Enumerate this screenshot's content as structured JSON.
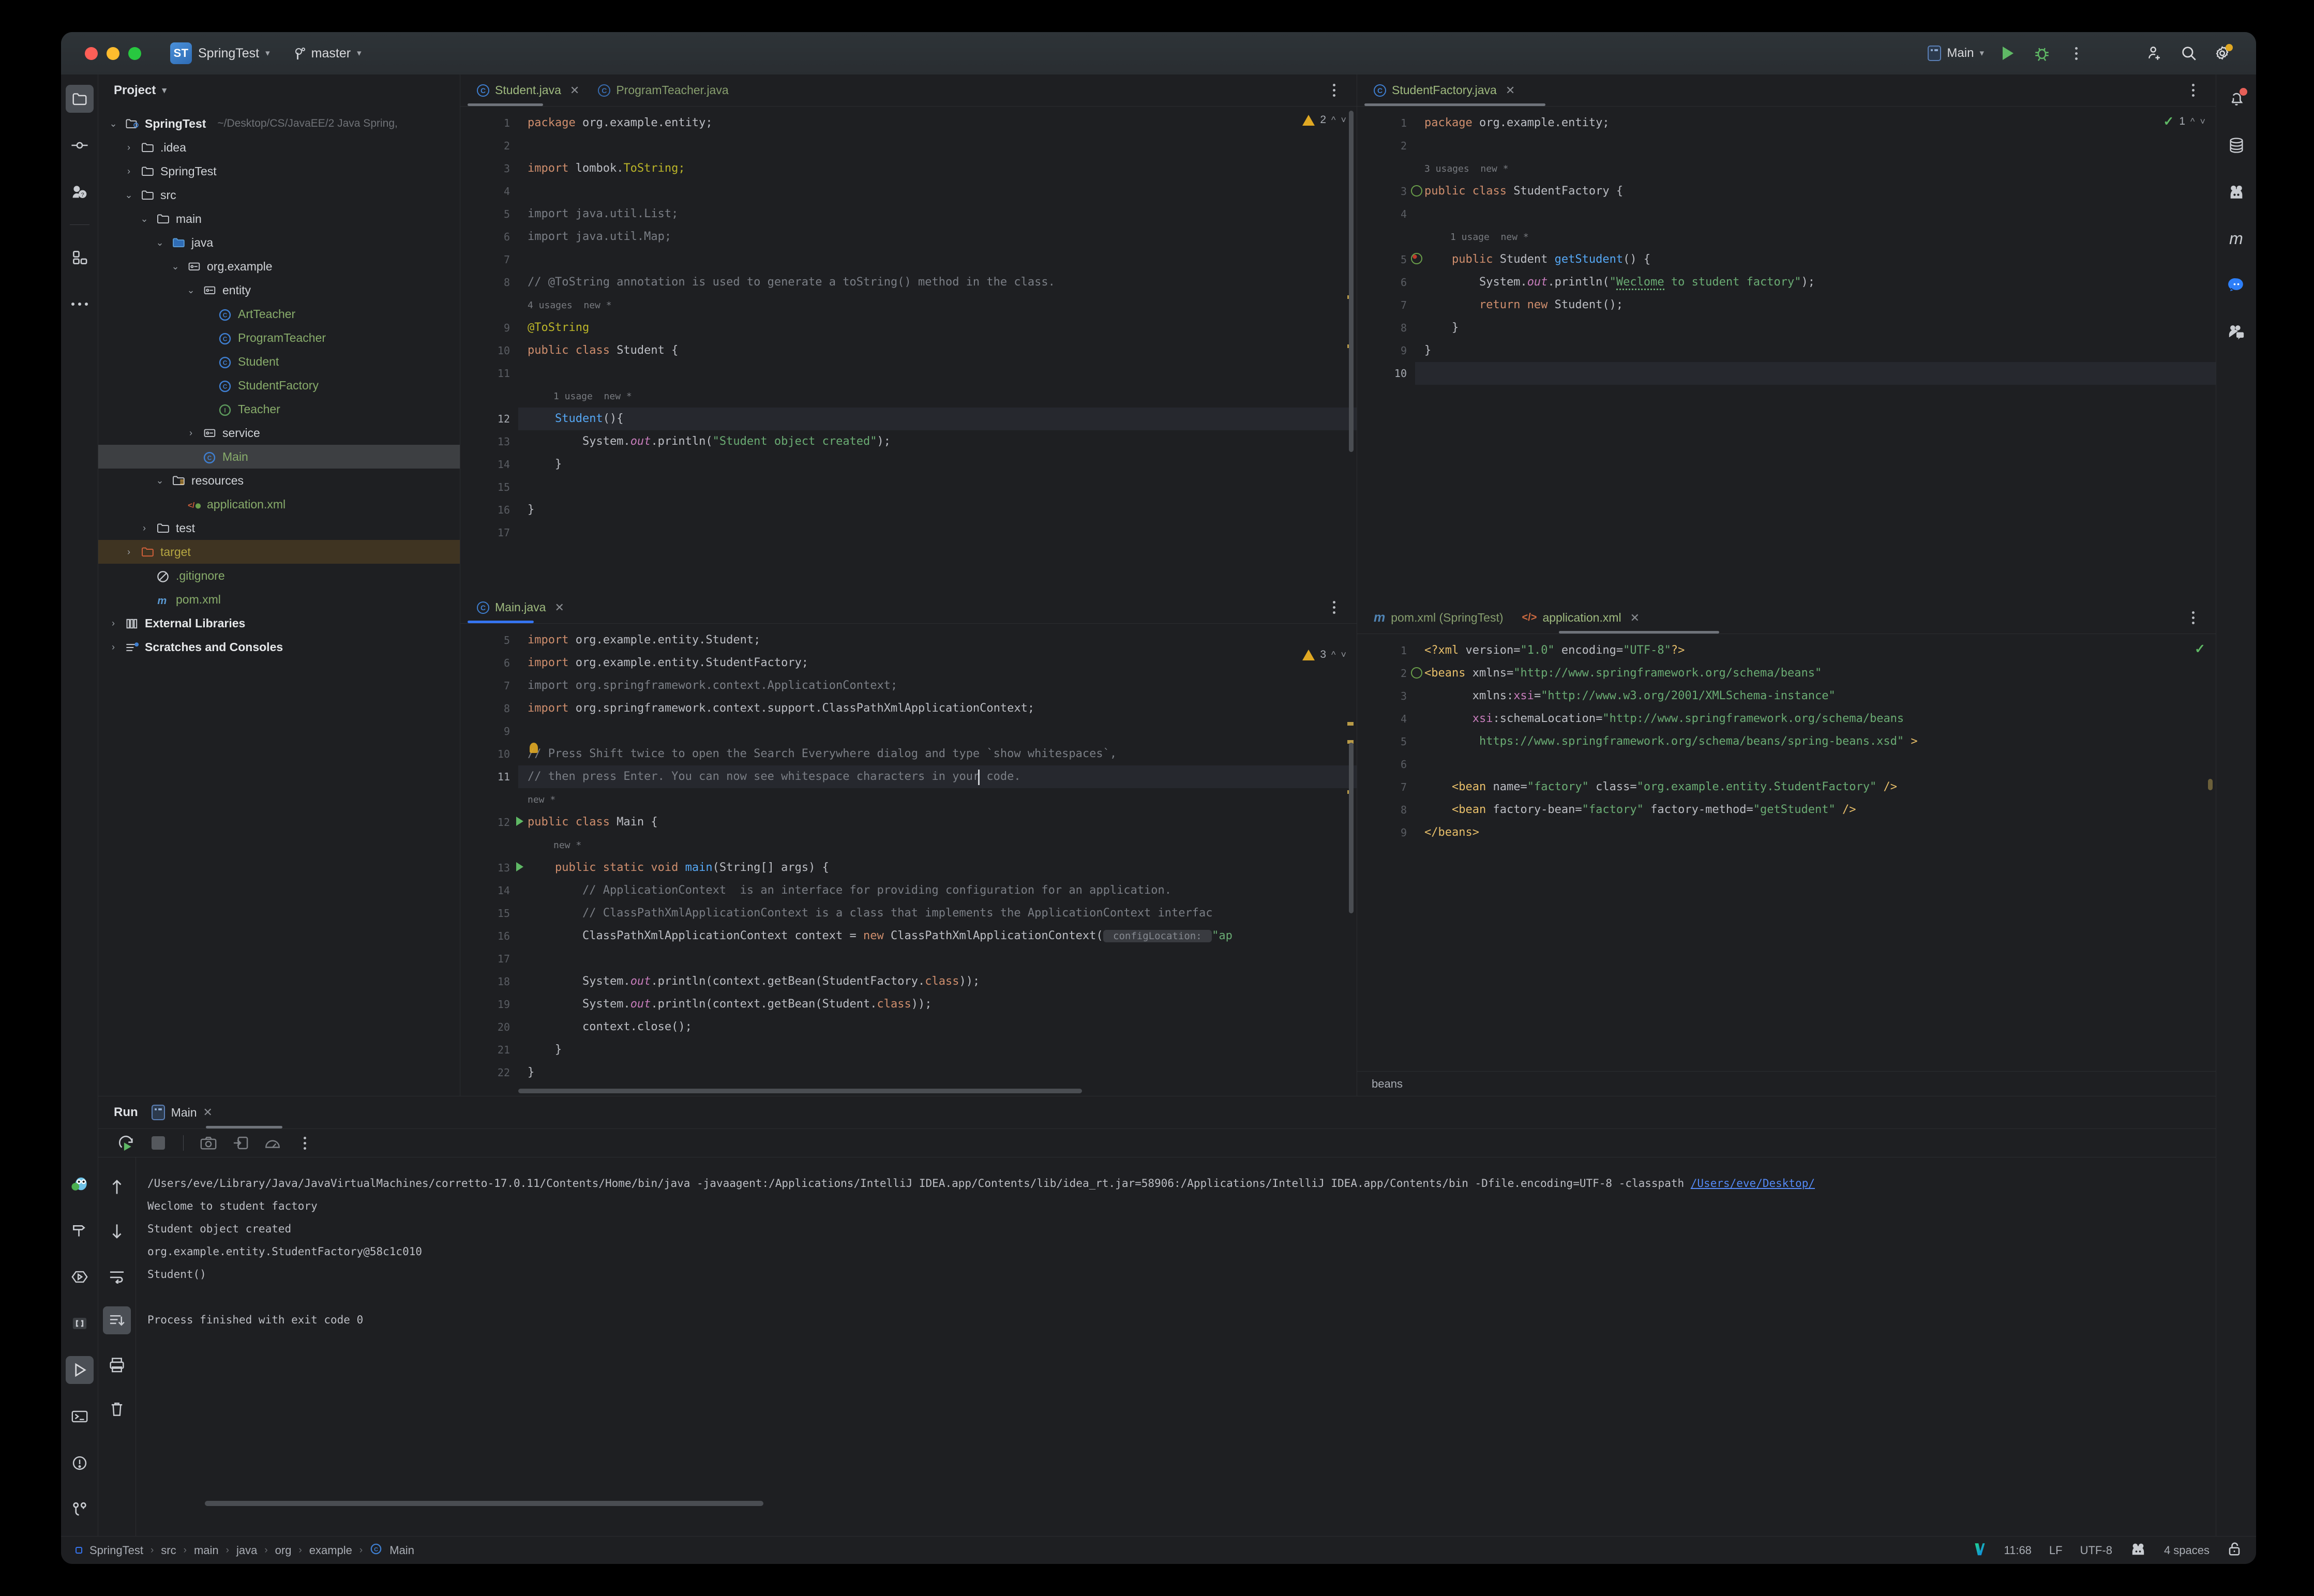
{
  "window": {
    "title": "SpringTest",
    "project_badge": "ST",
    "branch": "master"
  },
  "toolbar": {
    "run_config": "Main",
    "run_label": "Run",
    "debug_label": "Debug",
    "more_label": "More",
    "invite_label": "Code With Me",
    "search_label": "Search Everywhere",
    "settings_label": "Settings"
  },
  "project_pane": {
    "title": "Project",
    "tree": [
      {
        "label": "SpringTest",
        "path": "~/Desktop/CS/JavaEE/2 Java Spring,",
        "depth": 0,
        "arrow": "v",
        "icon": "module-folder",
        "bold": true
      },
      {
        "label": ".idea",
        "depth": 1,
        "arrow": ">",
        "icon": "folder"
      },
      {
        "label": "SpringTest",
        "depth": 1,
        "arrow": ">",
        "icon": "folder"
      },
      {
        "label": "src",
        "depth": 1,
        "arrow": "v",
        "icon": "folder"
      },
      {
        "label": "main",
        "depth": 2,
        "arrow": "v",
        "icon": "folder"
      },
      {
        "label": "java",
        "depth": 3,
        "arrow": "v",
        "icon": "source-folder"
      },
      {
        "label": "org.example",
        "depth": 4,
        "arrow": "v",
        "icon": "package"
      },
      {
        "label": "entity",
        "depth": 5,
        "arrow": "v",
        "icon": "package"
      },
      {
        "label": "ArtTeacher",
        "depth": 6,
        "arrow": "",
        "icon": "class"
      },
      {
        "label": "ProgramTeacher",
        "depth": 6,
        "arrow": "",
        "icon": "class"
      },
      {
        "label": "Student",
        "depth": 6,
        "arrow": "",
        "icon": "class"
      },
      {
        "label": "StudentFactory",
        "depth": 6,
        "arrow": "",
        "icon": "class"
      },
      {
        "label": "Teacher",
        "depth": 6,
        "arrow": "",
        "icon": "interface"
      },
      {
        "label": "service",
        "depth": 5,
        "arrow": ">",
        "icon": "package"
      },
      {
        "label": "Main",
        "depth": 5,
        "arrow": "",
        "icon": "class",
        "selected": true
      },
      {
        "label": "resources",
        "depth": 3,
        "arrow": "v",
        "icon": "resource-folder"
      },
      {
        "label": "application.xml",
        "depth": 4,
        "arrow": "",
        "icon": "xml"
      },
      {
        "label": "test",
        "depth": 2,
        "arrow": ">",
        "icon": "folder"
      },
      {
        "label": "target",
        "depth": 1,
        "arrow": ">",
        "icon": "excluded-folder",
        "highlight": true
      },
      {
        "label": ".gitignore",
        "depth": 2,
        "arrow": "",
        "icon": "gitignore"
      },
      {
        "label": "pom.xml",
        "depth": 2,
        "arrow": "",
        "icon": "maven"
      },
      {
        "label": "External Libraries",
        "depth": 0,
        "arrow": ">",
        "icon": "library",
        "bold": true
      },
      {
        "label": "Scratches and Consoles",
        "depth": 0,
        "arrow": ">",
        "icon": "scratches",
        "bold": true
      }
    ]
  },
  "editor_student": {
    "tabs": [
      {
        "label": "Student.java",
        "icon": "class",
        "active": true,
        "closable": true
      },
      {
        "label": "ProgramTeacher.java",
        "icon": "class",
        "active": false,
        "closable": false
      }
    ],
    "warnings": "2",
    "lines": [
      {
        "n": "1",
        "segs": [
          {
            "t": "package ",
            "c": "kw"
          },
          {
            "t": "org.example.entity;",
            "c": "typ"
          }
        ]
      },
      {
        "n": "2",
        "segs": []
      },
      {
        "n": "3",
        "segs": [
          {
            "t": "import ",
            "c": "kw"
          },
          {
            "t": "lombok.",
            "c": "typ"
          },
          {
            "t": "ToString;",
            "c": "anno"
          }
        ]
      },
      {
        "n": "4",
        "segs": []
      },
      {
        "n": "5",
        "segs": [
          {
            "t": "import java.util.List;",
            "c": "cmt"
          }
        ]
      },
      {
        "n": "6",
        "segs": [
          {
            "t": "import java.util.Map;",
            "c": "cmt"
          }
        ]
      },
      {
        "n": "7",
        "segs": []
      },
      {
        "n": "8",
        "segs": [
          {
            "t": "// @ToString annotation is used to generate a toString() method in the class.",
            "c": "cmt"
          }
        ]
      },
      {
        "n": "",
        "hint": "4 usages  new *"
      },
      {
        "n": "9",
        "segs": [
          {
            "t": "@ToString",
            "c": "anno"
          }
        ]
      },
      {
        "n": "10",
        "segs": [
          {
            "t": "public class ",
            "c": "kw"
          },
          {
            "t": "Student {",
            "c": "typ"
          }
        ]
      },
      {
        "n": "11",
        "segs": []
      },
      {
        "n": "",
        "hint": "1 usage  new *",
        "indent": 1
      },
      {
        "n": "12",
        "segs": [
          {
            "t": "    ",
            "c": "typ"
          },
          {
            "t": "Student",
            "c": "mth"
          },
          {
            "t": "(){",
            "c": "typ"
          }
        ],
        "current": true
      },
      {
        "n": "13",
        "segs": [
          {
            "t": "        System.",
            "c": "typ"
          },
          {
            "t": "out",
            "c": "fld"
          },
          {
            "t": ".println(",
            "c": "typ"
          },
          {
            "t": "\"Student object created\"",
            "c": "str"
          },
          {
            "t": ");",
            "c": "typ"
          }
        ]
      },
      {
        "n": "14",
        "segs": [
          {
            "t": "    }",
            "c": "typ"
          }
        ]
      },
      {
        "n": "15",
        "segs": []
      },
      {
        "n": "16",
        "segs": [
          {
            "t": "}",
            "c": "typ"
          }
        ]
      },
      {
        "n": "17",
        "segs": []
      }
    ]
  },
  "editor_main": {
    "tabs": [
      {
        "label": "Main.java",
        "icon": "class",
        "active": true,
        "closable": true
      }
    ],
    "warnings": "3",
    "lines": [
      {
        "n": "5",
        "segs": [
          {
            "t": "import ",
            "c": "kw"
          },
          {
            "t": "org.example.entity.Student;",
            "c": "typ"
          }
        ],
        "clipped": true
      },
      {
        "n": "6",
        "segs": [
          {
            "t": "import ",
            "c": "kw"
          },
          {
            "t": "org.example.entity.StudentFactory;",
            "c": "typ"
          }
        ]
      },
      {
        "n": "7",
        "segs": [
          {
            "t": "import org.springframework.context.ApplicationContext;",
            "c": "cmt"
          }
        ]
      },
      {
        "n": "8",
        "segs": [
          {
            "t": "import ",
            "c": "kw"
          },
          {
            "t": "org.springframework.context.support.ClassPathXmlApplicationContext;",
            "c": "typ"
          }
        ]
      },
      {
        "n": "9",
        "segs": []
      },
      {
        "n": "10",
        "segs": [
          {
            "t": "// Press Shift twice to open the Search Everywhere dialog and type `show whitespaces`,",
            "c": "cmt"
          }
        ],
        "bulb": true
      },
      {
        "n": "11",
        "segs": [
          {
            "t": "// then press Enter. You can now see whitespace characters in your code.",
            "c": "cmt"
          }
        ],
        "current": true,
        "caret_col": 66
      },
      {
        "n": "",
        "hint": "new *"
      },
      {
        "n": "12",
        "segs": [
          {
            "t": "public class ",
            "c": "kw"
          },
          {
            "t": "Main {",
            "c": "typ"
          }
        ],
        "gutter_run": true
      },
      {
        "n": "",
        "hint": "new *",
        "indent": 1
      },
      {
        "n": "13",
        "segs": [
          {
            "t": "    ",
            "c": "typ"
          },
          {
            "t": "public static void ",
            "c": "kw"
          },
          {
            "t": "main",
            "c": "mth"
          },
          {
            "t": "(String[] args) {",
            "c": "typ"
          }
        ],
        "gutter_run": true
      },
      {
        "n": "14",
        "segs": [
          {
            "t": "        // ApplicationContext  is an interface for providing configuration for an application.",
            "c": "cmt"
          }
        ]
      },
      {
        "n": "15",
        "segs": [
          {
            "t": "        // ClassPathXmlApplicationContext is a class that implements the ApplicationContext interfac",
            "c": "cmt"
          }
        ]
      },
      {
        "n": "16",
        "segs": [
          {
            "t": "        ClassPathXmlApplicationContext context = ",
            "c": "typ"
          },
          {
            "t": "new ",
            "c": "kw"
          },
          {
            "t": "ClassPathXmlApplicationContext(",
            "c": "typ"
          },
          {
            "t": " configLocation: ",
            "c": "pill"
          },
          {
            "t": "\"ap",
            "c": "str"
          }
        ]
      },
      {
        "n": "17",
        "segs": []
      },
      {
        "n": "18",
        "segs": [
          {
            "t": "        System.",
            "c": "typ"
          },
          {
            "t": "out",
            "c": "fld"
          },
          {
            "t": ".println(context.getBean(StudentFactory.",
            "c": "typ"
          },
          {
            "t": "class",
            "c": "kw"
          },
          {
            "t": "));",
            "c": "typ"
          }
        ]
      },
      {
        "n": "19",
        "segs": [
          {
            "t": "        System.",
            "c": "typ"
          },
          {
            "t": "out",
            "c": "fld"
          },
          {
            "t": ".println(context.getBean(Student.",
            "c": "typ"
          },
          {
            "t": "class",
            "c": "kw"
          },
          {
            "t": "));",
            "c": "typ"
          }
        ]
      },
      {
        "n": "20",
        "segs": [
          {
            "t": "        context.close();",
            "c": "typ"
          }
        ]
      },
      {
        "n": "21",
        "segs": [
          {
            "t": "    }",
            "c": "typ"
          }
        ]
      },
      {
        "n": "22",
        "segs": [
          {
            "t": "}",
            "c": "typ"
          }
        ]
      }
    ]
  },
  "editor_factory": {
    "tabs": [
      {
        "label": "StudentFactory.java",
        "icon": "class",
        "active": true,
        "closable": true
      }
    ],
    "inspection_ok": "1",
    "lines": [
      {
        "n": "1",
        "segs": [
          {
            "t": "package ",
            "c": "kw"
          },
          {
            "t": "org.example.entity;",
            "c": "typ"
          }
        ]
      },
      {
        "n": "2",
        "segs": []
      },
      {
        "n": "",
        "hint": "3 usages  new *"
      },
      {
        "n": "3",
        "segs": [
          {
            "t": "public class ",
            "c": "kw"
          },
          {
            "t": "StudentFactory {",
            "c": "typ"
          }
        ],
        "gutter_bean": true
      },
      {
        "n": "4",
        "segs": []
      },
      {
        "n": "",
        "hint": "1 usage  new *",
        "indent": 1
      },
      {
        "n": "5",
        "segs": [
          {
            "t": "    ",
            "c": "typ"
          },
          {
            "t": "public ",
            "c": "kw"
          },
          {
            "t": "Student ",
            "c": "typ"
          },
          {
            "t": "getStudent",
            "c": "mth"
          },
          {
            "t": "() {",
            "c": "typ"
          }
        ],
        "gutter_bean_method": true
      },
      {
        "n": "6",
        "segs": [
          {
            "t": "        System.",
            "c": "typ"
          },
          {
            "t": "out",
            "c": "fld"
          },
          {
            "t": ".println(",
            "c": "typ"
          },
          {
            "t": "\"",
            "c": "str"
          },
          {
            "t": "Weclome",
            "c": "str-sq"
          },
          {
            "t": " to student factory\"",
            "c": "str"
          },
          {
            "t": ");",
            "c": "typ"
          }
        ]
      },
      {
        "n": "7",
        "segs": [
          {
            "t": "        ",
            "c": "typ"
          },
          {
            "t": "return new ",
            "c": "kw"
          },
          {
            "t": "Student();",
            "c": "typ"
          }
        ]
      },
      {
        "n": "8",
        "segs": [
          {
            "t": "    }",
            "c": "typ"
          }
        ]
      },
      {
        "n": "9",
        "segs": [
          {
            "t": "}",
            "c": "typ"
          }
        ]
      },
      {
        "n": "10",
        "segs": [],
        "current": true
      }
    ]
  },
  "editor_xml": {
    "tabs": [
      {
        "label": "pom.xml (SpringTest)",
        "icon": "maven",
        "active": false,
        "closable": false
      },
      {
        "label": "application.xml",
        "icon": "xml",
        "active": true,
        "closable": true
      }
    ],
    "breadcrumb": "beans",
    "lines": [
      {
        "n": "1",
        "segs": [
          {
            "t": "<?xml ",
            "c": "xtag"
          },
          {
            "t": "version=",
            "c": "xattr"
          },
          {
            "t": "\"1.0\"",
            "c": "xval"
          },
          {
            "t": " encoding=",
            "c": "xattr"
          },
          {
            "t": "\"UTF-8\"",
            "c": "xval"
          },
          {
            "t": "?>",
            "c": "xtag"
          }
        ]
      },
      {
        "n": "2",
        "segs": [
          {
            "t": "<beans",
            "c": "xtag"
          },
          {
            "t": " xmlns=",
            "c": "xattr"
          },
          {
            "t": "\"http://www.springframework.org/schema/beans\"",
            "c": "xval"
          }
        ],
        "gutter_bean": true
      },
      {
        "n": "3",
        "segs": [
          {
            "t": "       xmlns:",
            "c": "xattr"
          },
          {
            "t": "xsi",
            "c": "xns"
          },
          {
            "t": "=",
            "c": "xattr"
          },
          {
            "t": "\"http://www.w3.org/2001/XMLSchema-instance\"",
            "c": "xval"
          }
        ]
      },
      {
        "n": "4",
        "segs": [
          {
            "t": "       ",
            "c": "xattr"
          },
          {
            "t": "xsi",
            "c": "xns"
          },
          {
            "t": ":schemaLocation=",
            "c": "xattr"
          },
          {
            "t": "\"http://www.springframework.org/schema/beans",
            "c": "xval"
          }
        ]
      },
      {
        "n": "5",
        "segs": [
          {
            "t": "        https://www.springframework.org/schema/beans/spring-beans.xsd\"",
            "c": "xval"
          },
          {
            "t": " >",
            "c": "xtag"
          }
        ]
      },
      {
        "n": "6",
        "segs": []
      },
      {
        "n": "7",
        "segs": [
          {
            "t": "    <bean",
            "c": "xtag"
          },
          {
            "t": " name=",
            "c": "xattr"
          },
          {
            "t": "\"factory\"",
            "c": "xval"
          },
          {
            "t": " class=",
            "c": "xattr"
          },
          {
            "t": "\"org.example.entity.StudentFactory\"",
            "c": "xval"
          },
          {
            "t": " />",
            "c": "xtag"
          }
        ]
      },
      {
        "n": "8",
        "segs": [
          {
            "t": "    <bean",
            "c": "xtag"
          },
          {
            "t": " factory-bean=",
            "c": "xattr"
          },
          {
            "t": "\"factory\"",
            "c": "xval"
          },
          {
            "t": " factory-method=",
            "c": "xattr"
          },
          {
            "t": "\"getStudent\"",
            "c": "xval"
          },
          {
            "t": " />",
            "c": "xtag"
          }
        ]
      },
      {
        "n": "9",
        "segs": [
          {
            "t": "</beans>",
            "c": "xtag"
          }
        ],
        "highlight_tag": true
      }
    ]
  },
  "run_console": {
    "title": "Run",
    "tab": "Main",
    "toolbar": [
      "rerun-icon",
      "stop-icon",
      "camera-icon",
      "login-icon",
      "profiler-icon",
      "more-icon"
    ],
    "output": [
      {
        "text": "/Users/eve/Library/Java/JavaVirtualMachines/corretto-17.0.11/Contents/Home/bin/java -javaagent:/Applications/IntelliJ IDEA.app/Contents/lib/idea_rt.jar=58906:/Applications/IntelliJ IDEA.app/Contents/bin -Dfile.encoding=UTF-8 -classpath ",
        "link": "/Users/eve/Desktop/"
      },
      {
        "text": "Weclome to student factory"
      },
      {
        "text": "Student object created"
      },
      {
        "text": "org.example.entity.StudentFactory@58c1c010"
      },
      {
        "text": "Student()"
      },
      {
        "text": ""
      },
      {
        "text": "Process finished with exit code 0"
      }
    ]
  },
  "statusbar": {
    "breadcrumb": [
      "SpringTest",
      "src",
      "main",
      "java",
      "org",
      "example",
      "Main"
    ],
    "caret": "11:68",
    "line_sep": "LF",
    "encoding": "UTF-8",
    "indent": "4 spaces"
  }
}
